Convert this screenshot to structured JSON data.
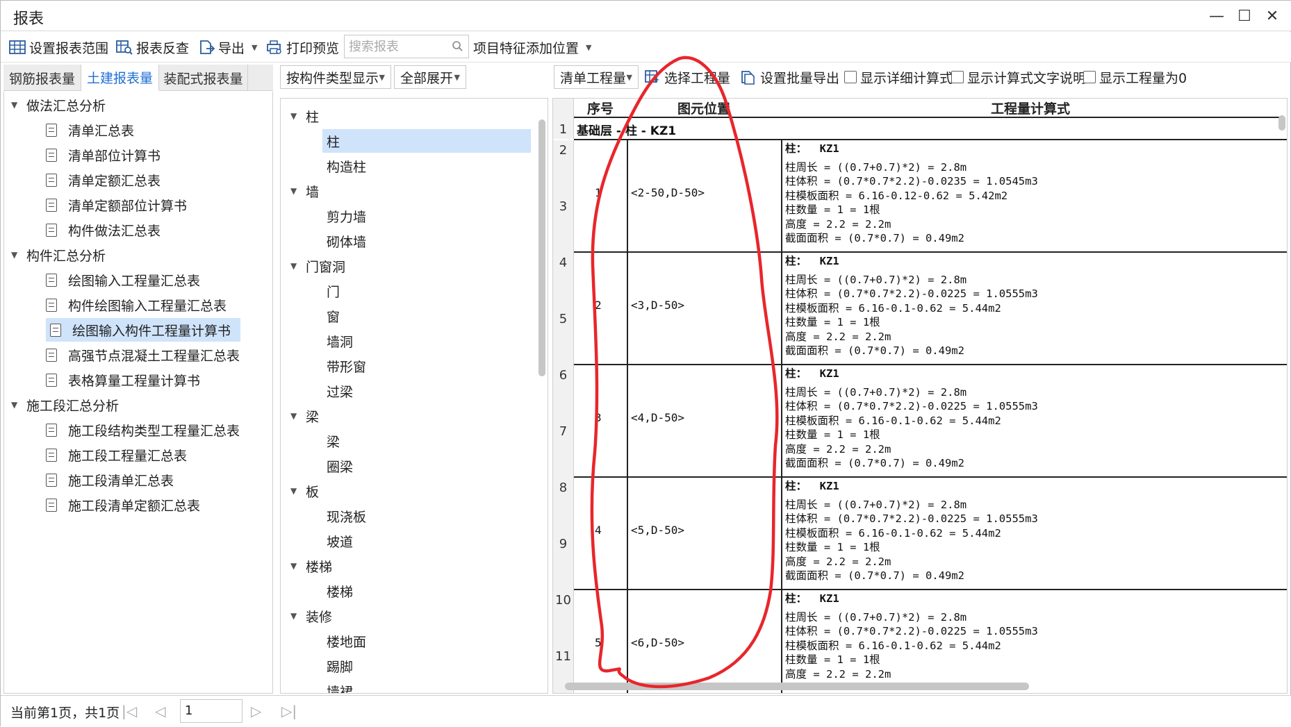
{
  "window": {
    "title": "报表"
  },
  "toolbar": {
    "set_range": "设置报表范围",
    "reverse_check": "报表反查",
    "export": "导出",
    "print_preview": "打印预览",
    "search_placeholder": "搜索报表",
    "feature_position": "项目特征添加位置"
  },
  "left_tabs": [
    "钢筋报表量",
    "土建报表量",
    "装配式报表量"
  ],
  "left_tree": {
    "groups": [
      {
        "label": "做法汇总分析",
        "items": [
          "清单汇总表",
          "清单部位计算书",
          "清单定额汇总表",
          "清单定额部位计算书",
          "构件做法汇总表"
        ]
      },
      {
        "label": "构件汇总分析",
        "items": [
          "绘图输入工程量汇总表",
          "构件绘图输入工程量汇总表",
          "绘图输入构件工程量计算书",
          "高强节点混凝土工程量汇总表",
          "表格算量工程量计算书"
        ]
      },
      {
        "label": "施工段汇总分析",
        "items": [
          "施工段结构类型工程量汇总表",
          "施工段工程量汇总表",
          "施工段清单汇总表",
          "施工段清单定额汇总表"
        ]
      }
    ],
    "selected": "绘图输入构件工程量计算书"
  },
  "mid_header": {
    "display_mode": "按构件类型显示",
    "expand": "全部展开"
  },
  "mid_tree": {
    "groups": [
      {
        "label": "柱",
        "items": [
          "柱",
          "构造柱"
        ]
      },
      {
        "label": "墙",
        "items": [
          "剪力墙",
          "砌体墙"
        ]
      },
      {
        "label": "门窗洞",
        "items": [
          "门",
          "窗",
          "墙洞",
          "带形窗",
          "过梁"
        ]
      },
      {
        "label": "梁",
        "items": [
          "梁",
          "圈梁"
        ]
      },
      {
        "label": "板",
        "items": [
          "现浇板",
          "坡道"
        ]
      },
      {
        "label": "楼梯",
        "items": [
          "楼梯"
        ]
      },
      {
        "label": "装修",
        "items": [
          "楼地面",
          "踢脚",
          "墙裙"
        ]
      }
    ],
    "selected": "柱"
  },
  "right_header": {
    "quantity_type": "清单工程量",
    "select_quantity": "选择工程量",
    "batch_export": "设置批量导出",
    "show_detail": "显示详细计算式",
    "show_text": "显示计算式文字说明",
    "show_zero": "显示工程量为0"
  },
  "grid": {
    "headers": [
      "序号",
      "图元位置",
      "工程量计算式"
    ],
    "row_numbers": [
      "1",
      "2",
      "3",
      "4",
      "5",
      "6",
      "7",
      "8",
      "9",
      "10",
      "11"
    ],
    "section_title": "基础层 - 柱 - KZ1",
    "records": [
      {
        "no": "1",
        "pos": "<2-50,D-50>",
        "head": "柱：  KZ1",
        "lines": [
          "柱周长 = ((0.7+0.7)*2) = 2.8m",
          "柱体积 = (0.7*0.7*2.2)-0.0235 = 1.0545m3",
          "柱模板面积 = 6.16-0.12-0.62 = 5.42m2",
          "柱数量 = 1 = 1根",
          "高度 = 2.2 = 2.2m",
          "截面面积 = (0.7*0.7) = 0.49m2"
        ]
      },
      {
        "no": "2",
        "pos": "<3,D-50>",
        "head": "柱：  KZ1",
        "lines": [
          "柱周长 = ((0.7+0.7)*2) = 2.8m",
          "柱体积 = (0.7*0.7*2.2)-0.0225 = 1.0555m3",
          "柱模板面积 = 6.16-0.1-0.62 = 5.44m2",
          "柱数量 = 1 = 1根",
          "高度 = 2.2 = 2.2m",
          "截面面积 = (0.7*0.7) = 0.49m2"
        ]
      },
      {
        "no": "3",
        "pos": "<4,D-50>",
        "head": "柱：  KZ1",
        "lines": [
          "柱周长 = ((0.7+0.7)*2) = 2.8m",
          "柱体积 = (0.7*0.7*2.2)-0.0225 = 1.0555m3",
          "柱模板面积 = 6.16-0.1-0.62 = 5.44m2",
          "柱数量 = 1 = 1根",
          "高度 = 2.2 = 2.2m",
          "截面面积 = (0.7*0.7) = 0.49m2"
        ]
      },
      {
        "no": "4",
        "pos": "<5,D-50>",
        "head": "柱：  KZ1",
        "lines": [
          "柱周长 = ((0.7+0.7)*2) = 2.8m",
          "柱体积 = (0.7*0.7*2.2)-0.0225 = 1.0555m3",
          "柱模板面积 = 6.16-0.1-0.62 = 5.44m2",
          "柱数量 = 1 = 1根",
          "高度 = 2.2 = 2.2m",
          "截面面积 = (0.7*0.7) = 0.49m2"
        ]
      },
      {
        "no": "5",
        "pos": "<6,D-50>",
        "head": "柱：  KZ1",
        "lines": [
          "柱周长 = ((0.7+0.7)*2) = 2.8m",
          "柱体积 = (0.7*0.7*2.2)-0.0225 = 1.0555m3",
          "柱模板面积 = 6.16-0.1-0.62 = 5.44m2",
          "柱数量 = 1 = 1根",
          "高度 = 2.2 = 2.2m"
        ]
      }
    ]
  },
  "status": {
    "page_info": "当前第1页，共1页",
    "page_value": "1"
  },
  "colors": {
    "accent": "#1f6fd6",
    "selection": "#cfe3fb",
    "annotation": "#e8262b"
  }
}
